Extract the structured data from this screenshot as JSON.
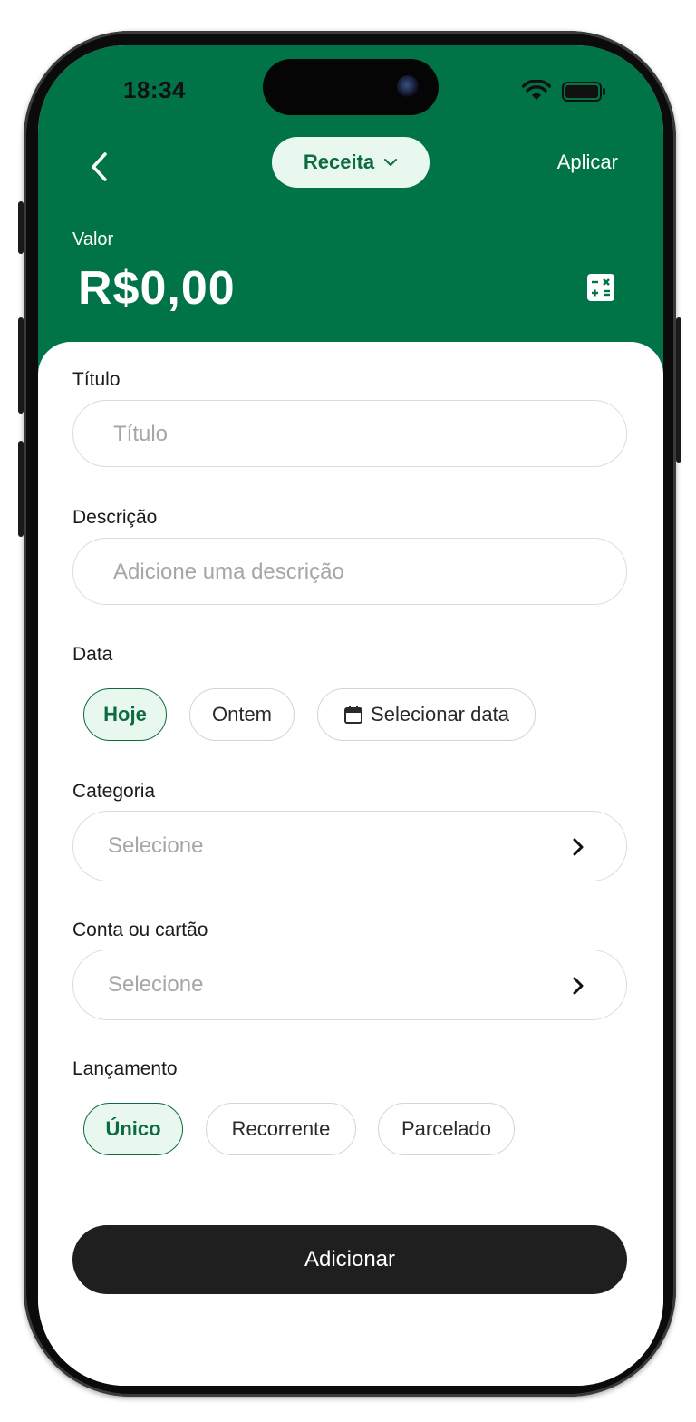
{
  "status_bar": {
    "time": "18:34",
    "signal_dots": "...."
  },
  "header": {
    "type_selector": "Receita",
    "apply_label": "Aplicar",
    "value_label": "Valor",
    "value_amount": "R$0,00",
    "background_color": "#017447"
  },
  "form": {
    "titulo": {
      "label": "Título",
      "placeholder": "Título"
    },
    "descricao": {
      "label": "Descrição",
      "placeholder": "Adicione uma descrição"
    },
    "data": {
      "label": "Data",
      "options": [
        "Hoje",
        "Ontem",
        "Selecionar data"
      ],
      "selected": "Hoje"
    },
    "categoria": {
      "label": "Categoria",
      "placeholder": "Selecione"
    },
    "conta": {
      "label": "Conta ou cartão",
      "placeholder": "Selecione"
    },
    "lancamento": {
      "label": "Lançamento",
      "options": [
        "Único",
        "Recorrente",
        "Parcelado"
      ],
      "selected": "Único"
    }
  },
  "submit_label": "Adicionar",
  "icons": {
    "back": "chevron-left-icon",
    "type_dropdown": "chevron-down-icon",
    "calculator": "calculator-icon",
    "calendar": "calendar-icon",
    "select_arrow": "chevron-right-icon",
    "wifi": "wifi-icon",
    "battery": "battery-icon"
  },
  "colors": {
    "accent": "#0e6b40",
    "accent_light": "#e8f8ef",
    "button_dark": "#1f1f1f"
  }
}
